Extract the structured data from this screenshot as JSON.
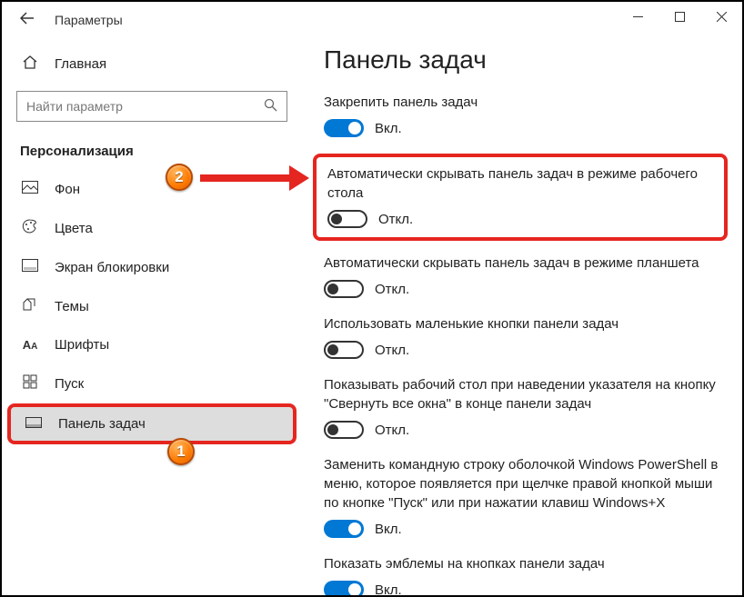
{
  "window": {
    "title": "Параметры"
  },
  "sidebar": {
    "home": "Главная",
    "search_placeholder": "Найти параметр",
    "category": "Персонализация",
    "items": [
      {
        "label": "Фон"
      },
      {
        "label": "Цвета"
      },
      {
        "label": "Экран блокировки"
      },
      {
        "label": "Темы"
      },
      {
        "label": "Шрифты"
      },
      {
        "label": "Пуск"
      },
      {
        "label": "Панель задач"
      }
    ]
  },
  "main": {
    "heading": "Панель задач",
    "settings": [
      {
        "label": "Закрепить панель задач",
        "state": "Вкл.",
        "on": true
      },
      {
        "label": "Автоматически скрывать панель задач в режиме рабочего стола",
        "state": "Откл.",
        "on": false
      },
      {
        "label": "Автоматически скрывать панель задач в режиме планшета",
        "state": "Откл.",
        "on": false
      },
      {
        "label": "Использовать маленькие кнопки панели задач",
        "state": "Откл.",
        "on": false
      },
      {
        "label": "Показывать рабочий стол при наведении указателя на кнопку \"Свернуть все окна\" в конце панели задач",
        "state": "Откл.",
        "on": false
      },
      {
        "label": "Заменить командную строку оболочкой Windows PowerShell в меню, которое появляется при щелчке правой кнопкой мыши по кнопке \"Пуск\" или при нажатии клавиш Windows+X",
        "state": "Вкл.",
        "on": true
      },
      {
        "label": "Показать эмблемы на кнопках панели задач",
        "state": "Вкл.",
        "on": true
      }
    ]
  },
  "annotations": {
    "step1": "1",
    "step2": "2"
  }
}
